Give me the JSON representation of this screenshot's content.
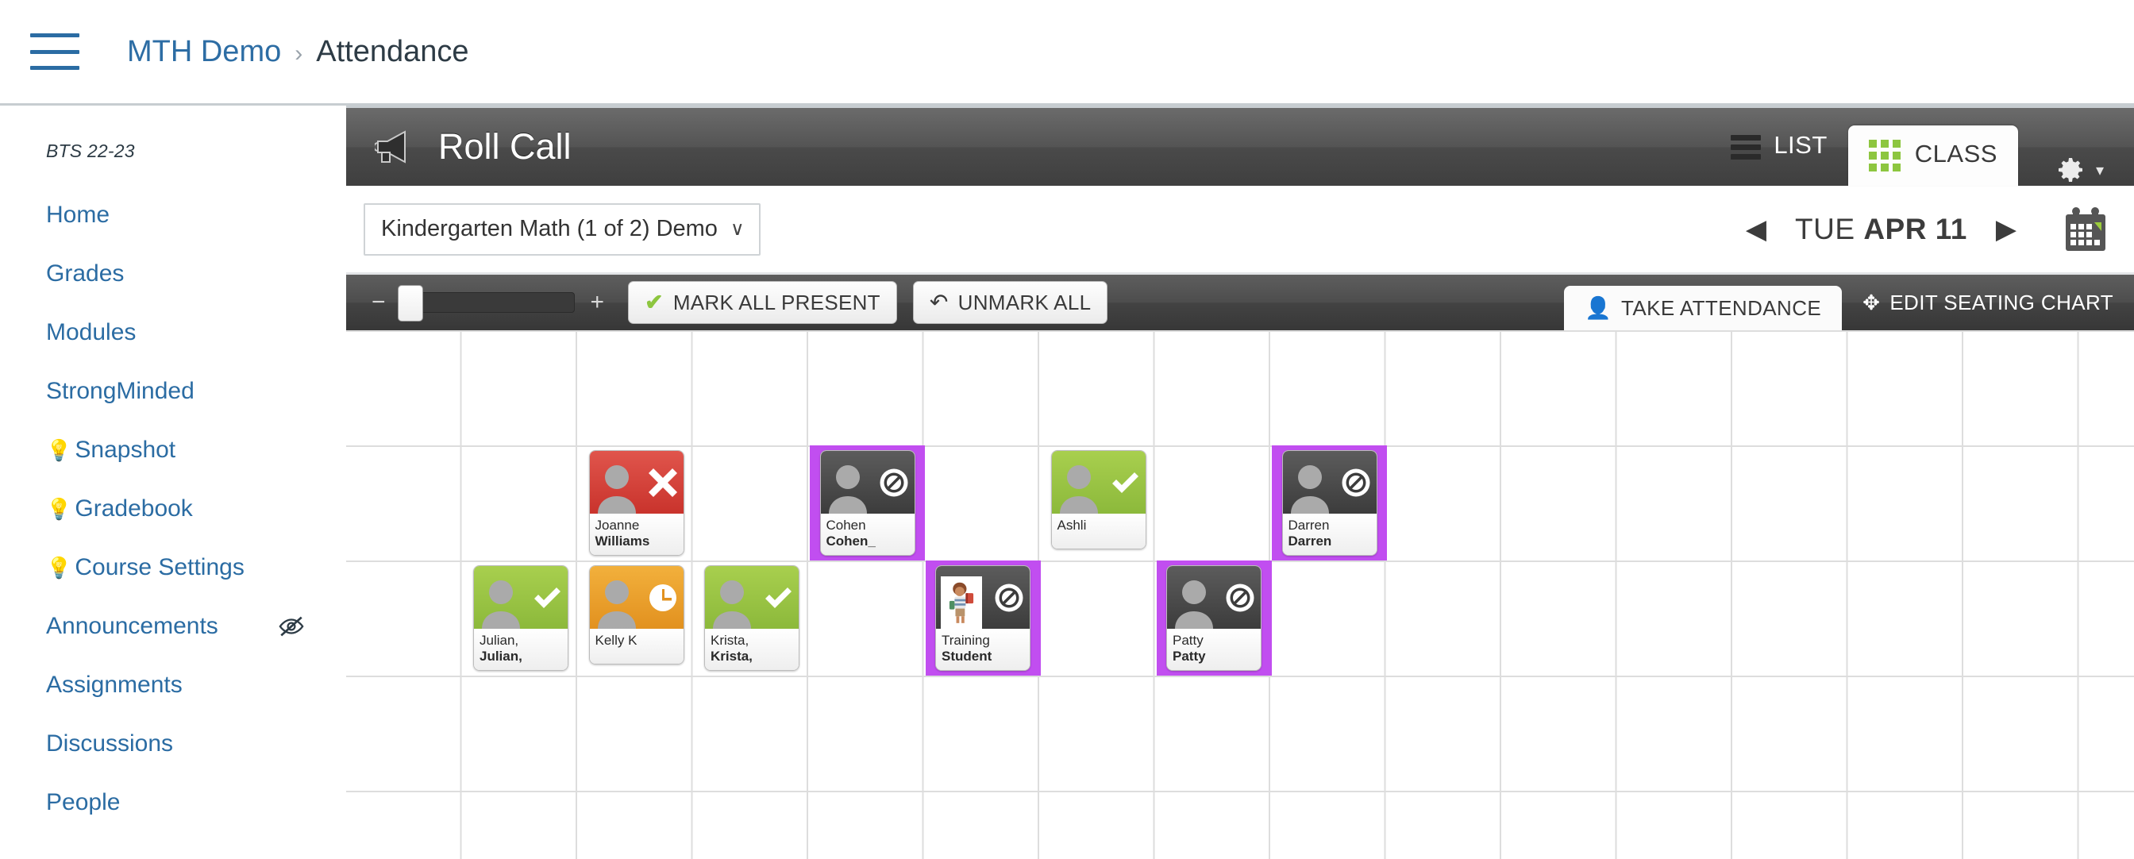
{
  "breadcrumb": {
    "course": "MTH Demo",
    "separator": "›",
    "current": "Attendance",
    "menu_icon": "hamburger-icon"
  },
  "sidebar": {
    "term": "BTS 22-23",
    "items": [
      {
        "label": "Home",
        "bulb": false,
        "eye_off": false
      },
      {
        "label": "Grades",
        "bulb": false,
        "eye_off": false
      },
      {
        "label": "Modules",
        "bulb": false,
        "eye_off": false
      },
      {
        "label": "StrongMinded",
        "bulb": false,
        "eye_off": false
      },
      {
        "label": "Snapshot",
        "bulb": true,
        "eye_off": false,
        "bulb_glyph": "💡"
      },
      {
        "label": "Gradebook",
        "bulb": true,
        "eye_off": false,
        "bulb_glyph": "💡"
      },
      {
        "label": "Course Settings",
        "bulb": true,
        "eye_off": false,
        "bulb_glyph": "💡"
      },
      {
        "label": "Announcements",
        "bulb": false,
        "eye_off": true
      },
      {
        "label": "Assignments",
        "bulb": false,
        "eye_off": false
      },
      {
        "label": "Discussions",
        "bulb": false,
        "eye_off": false
      },
      {
        "label": "People",
        "bulb": false,
        "eye_off": false
      }
    ]
  },
  "rollcall": {
    "title": "Roll Call",
    "title_icon": "megaphone-icon",
    "views": [
      {
        "label": "LIST",
        "icon": "list-icon",
        "active": false
      },
      {
        "label": "CLASS",
        "icon": "grid-icon",
        "active": true
      }
    ],
    "settings_icon": "gear-icon",
    "settings_caret": "▾"
  },
  "subbar": {
    "course_selected": "Kindergarten Math (1 of 2) Demo",
    "course_caret": "∨",
    "prev_arrow": "◀",
    "next_arrow": "▶",
    "date_weekday": "TUE ",
    "date_value": "APR 11",
    "calendar_icon": "calendar-icon"
  },
  "toolbar": {
    "zoom_out": "−",
    "zoom_in": "+",
    "zoom_value": 0,
    "mark_all_present": "MARK ALL PRESENT",
    "mark_all_present_icon": "✔",
    "unmark_all": "UNMARK ALL",
    "unmark_all_icon": "↶",
    "take_attendance": "TAKE ATTENDANCE",
    "take_attendance_icon": "👤",
    "edit_seating_chart": "EDIT SEATING CHART",
    "edit_seating_chart_icon": "✥",
    "tabs_active": "TAKE ATTENDANCE"
  },
  "seating_chart": {
    "columns": 16,
    "rows": 6,
    "highlight_color": "#c14ef0",
    "status_colors": {
      "present": "#8cb93b",
      "absent": "#c9332c",
      "late": "#e2911f",
      "unmarked": "#3c3c3c"
    },
    "students": [
      {
        "first": "Joanne",
        "last": "Williams",
        "status": "absent",
        "badge": "x-mark-icon",
        "col": 2,
        "row": 1,
        "highlight": false,
        "photo": "silhouette"
      },
      {
        "first": "Cohen",
        "last": "Cohen_",
        "status": "unmarked",
        "badge": "no-entry-icon",
        "col": 4,
        "row": 1,
        "highlight": true,
        "photo": "silhouette"
      },
      {
        "first": "Ashli",
        "last": "",
        "status": "present",
        "badge": "check-icon",
        "col": 6,
        "row": 1,
        "highlight": false,
        "photo": "silhouette"
      },
      {
        "first": "Darren",
        "last": "Darren",
        "status": "unmarked",
        "badge": "no-entry-icon",
        "col": 8,
        "row": 1,
        "highlight": true,
        "photo": "silhouette"
      },
      {
        "first": "Julian,",
        "last": "Julian,",
        "status": "present",
        "badge": "check-icon",
        "col": 1,
        "row": 2,
        "highlight": false,
        "photo": "silhouette"
      },
      {
        "first": "Kelly K",
        "last": "",
        "status": "late",
        "badge": "clock-icon",
        "col": 2,
        "row": 2,
        "highlight": false,
        "photo": "silhouette"
      },
      {
        "first": "Krista,",
        "last": "Krista,",
        "status": "present",
        "badge": "check-icon",
        "col": 3,
        "row": 2,
        "highlight": false,
        "photo": "silhouette"
      },
      {
        "first": "Training",
        "last": "Student",
        "status": "unmarked",
        "badge": "no-entry-icon",
        "col": 5,
        "row": 2,
        "highlight": true,
        "photo": "student-avatar"
      },
      {
        "first": "Patty",
        "last": "Patty",
        "status": "unmarked",
        "badge": "no-entry-icon",
        "col": 7,
        "row": 2,
        "highlight": true,
        "photo": "silhouette"
      }
    ]
  }
}
